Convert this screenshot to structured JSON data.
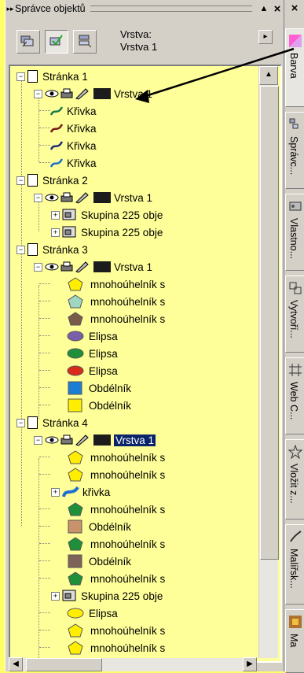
{
  "docker": {
    "title": "Správce objektů",
    "layer_label": "Vrstva:",
    "layer_value": "Vrstva 1"
  },
  "tree": {
    "pages": [
      {
        "label": "Stránka 1",
        "layer": "Vrstva 1"
      },
      {
        "label": "Stránka 2",
        "layer": "Vrstva 1"
      },
      {
        "label": "Stránka 3",
        "layer": "Vrstva 1"
      },
      {
        "label": "Stránka 4",
        "layer": "Vrstva 1"
      }
    ],
    "page1_items": [
      "Křivka",
      "Křivka",
      "Křivka",
      "Křivka"
    ],
    "page2_items": [
      "Skupina 225 obje",
      "Skupina 225 obje"
    ],
    "page3_items": [
      "mnohoúhelník s",
      "mnohoúhelník s",
      "mnohoúhelník s",
      "Elipsa",
      "Elipsa",
      "Elipsa",
      "Obdélník",
      "Obdélník"
    ],
    "page4_items": [
      "mnohoúhelník s",
      "mnohoúhelník s",
      "křivka",
      "mnohoúhelník s",
      "Obdélník",
      "mnohoúhelník s",
      "Obdélník",
      "mnohoúhelník s",
      "Skupina 225 obje",
      "Elipsa",
      "mnohoúhelník s",
      "mnohoúhelník s"
    ]
  },
  "tabs": [
    "Barva",
    "Správc...",
    "Vlastno...",
    "Vytvoří...",
    "Web C...",
    "Vložit z...",
    "Malířsk...",
    "Ma"
  ],
  "colors": {
    "background": "#ffff66",
    "tree_bg": "#ffff99",
    "selection": "#0a246a",
    "yellow": "#ffee00",
    "mint": "#9fd6c0",
    "brown": "#7a5a48",
    "purple": "#7b5ea8",
    "green": "#1f8f3a",
    "red": "#d92b1a",
    "blue": "#1a7fd4",
    "tan": "#c8926a",
    "taupe": "#7e6458",
    "curve_green": "#1a7a4a",
    "curve_darkred": "#7a1a1a",
    "curve_navy": "#1a2f7a",
    "curve_blue": "#1a6fd0"
  }
}
